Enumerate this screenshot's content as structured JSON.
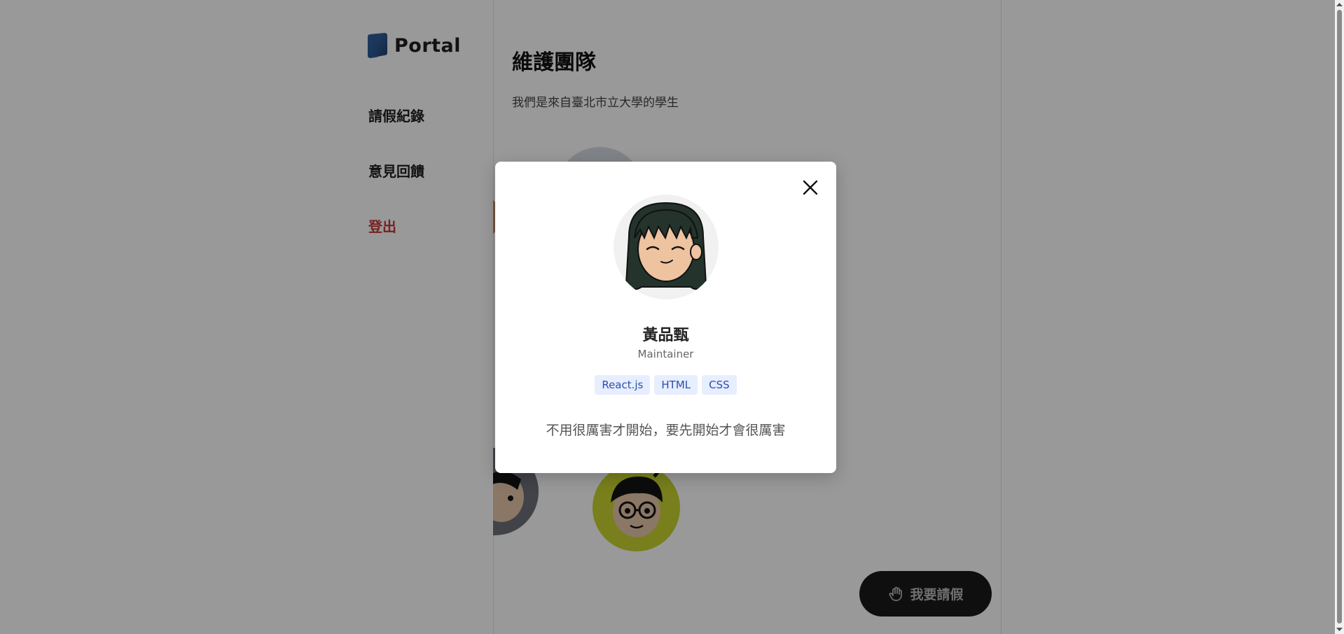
{
  "brand": {
    "name": "Portal",
    "icon": "portal-logo-icon"
  },
  "nav": {
    "items": [
      {
        "label": "請假紀錄"
      },
      {
        "label": "意見回饋"
      }
    ],
    "logout": "登出"
  },
  "page": {
    "title": "維護團隊",
    "subtitle": "我們是來自臺北市立大學的學生"
  },
  "modal": {
    "name": "黃品甄",
    "role": "Maintainer",
    "tags": [
      "React.js",
      "HTML",
      "CSS"
    ],
    "quote": "不用很厲害才開始，要先開始才會很厲害",
    "close_icon": "close-icon"
  },
  "fab": {
    "label": "我要請假",
    "icon": "raised-hand-icon"
  },
  "colors": {
    "logout": "#c53a3a",
    "fab_bg": "#1a1a1a",
    "tag_bg": "#e6eeff",
    "tag_text": "#2c4fa8",
    "avatar_bg_lime": "#c8d430",
    "avatar_bg_gray": "#6d7078"
  }
}
